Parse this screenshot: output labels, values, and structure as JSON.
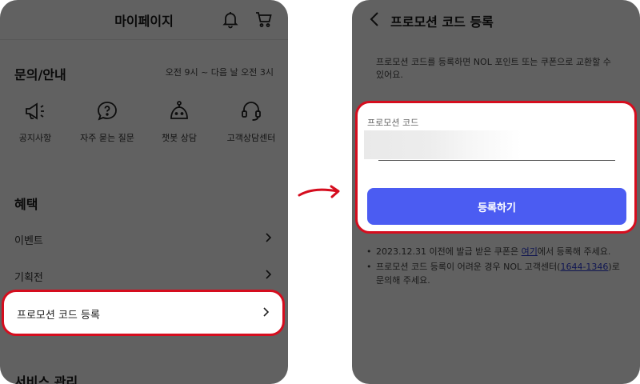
{
  "colors": {
    "accent": "#4b5cf2",
    "highlight": "#d50d1e",
    "overlay": "rgba(0,0,0,0.62)"
  },
  "left": {
    "header": {
      "title": "마이페이지",
      "icons": [
        "bell-icon",
        "cart-icon"
      ]
    },
    "support": {
      "title": "문의/안내",
      "hours": "오전 9시 ~ 다음 날 오전 3시",
      "items": [
        {
          "label": "공지사항",
          "icon": "megaphone-icon"
        },
        {
          "label": "자주 묻는 질문",
          "icon": "question-bubble-icon"
        },
        {
          "label": "챗봇 상담",
          "icon": "chatbot-icon"
        },
        {
          "label": "고객상담센터",
          "icon": "headset-icon"
        }
      ]
    },
    "benefits": {
      "title": "혜택",
      "items": [
        {
          "label": "이벤트"
        },
        {
          "label": "기획전"
        },
        {
          "label": "프로모션 코드 등록"
        }
      ]
    },
    "service": {
      "title": "서비스 관리"
    }
  },
  "right": {
    "header": {
      "title": "프로모션 코드 등록"
    },
    "description": "프로모션 코드를 등록하면 NOL 포인트 또는 쿠폰으로 교환할 수 있어요.",
    "field": {
      "label": "프로모션 코드",
      "value": ""
    },
    "button": {
      "label": "등록하기"
    },
    "notes": [
      {
        "before": "2023.12.31 이전에 발급 받은 쿠폰은 ",
        "link": "여기",
        "after": "에서 등록해 주세요."
      },
      {
        "before": "프로모션 코드 등록이 어려운 경우 NOL 고객센터(",
        "link": "1644-1346",
        "after": ")로 문의해 주세요."
      }
    ]
  }
}
